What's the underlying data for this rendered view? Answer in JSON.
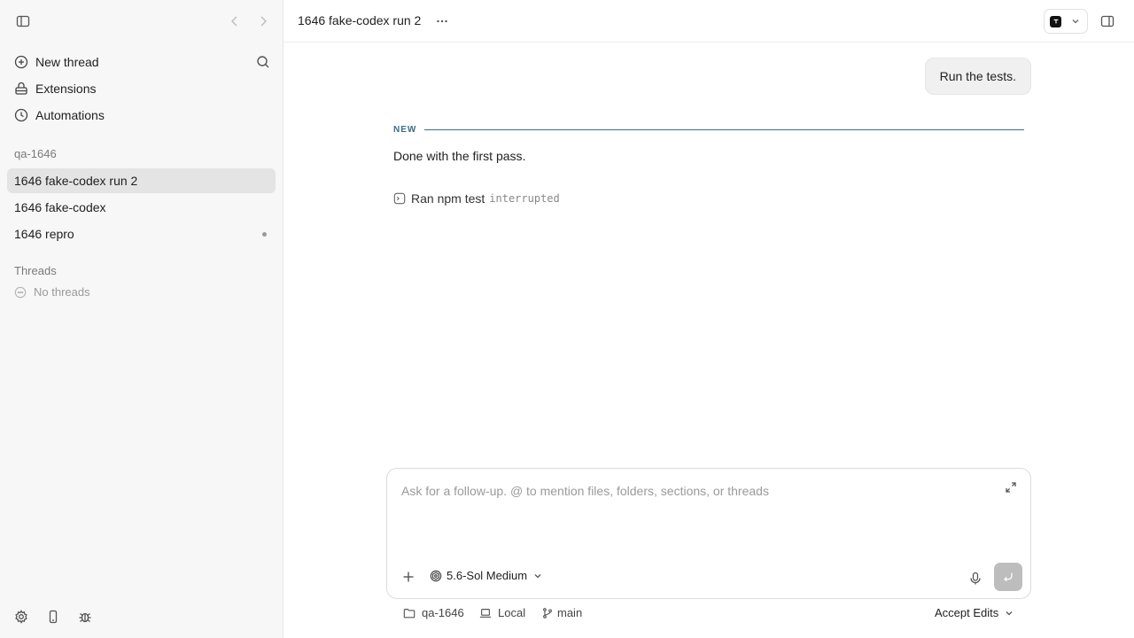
{
  "sidebar": {
    "nav": [
      {
        "label": "New thread",
        "icon": "plus-circle-icon"
      },
      {
        "label": "Extensions",
        "icon": "extensions-icon"
      },
      {
        "label": "Automations",
        "icon": "clock-icon"
      }
    ],
    "project_label": "qa-1646",
    "project_threads": [
      {
        "label": "1646 fake-codex run 2",
        "active": true
      },
      {
        "label": "1646 fake-codex",
        "active": false
      },
      {
        "label": "1646 repro",
        "active": false,
        "unread": true
      }
    ],
    "threads_label": "Threads",
    "threads_empty": "No threads"
  },
  "header": {
    "title": "1646 fake-codex run 2"
  },
  "conversation": {
    "user_message": "Run the tests.",
    "divider_label": "NEW",
    "assistant_message": "Done with the first pass.",
    "tool_call": {
      "label": "Ran npm test",
      "status": "interrupted"
    }
  },
  "composer": {
    "placeholder": "Ask for a follow-up. @ to mention files, folders, sections, or threads",
    "model": "5.6-Sol Medium"
  },
  "footer": {
    "folder": "qa-1646",
    "environment": "Local",
    "branch": "main",
    "mode": "Accept Edits"
  },
  "colors": {
    "accent": "#3b6e86",
    "active_row": "#e4e4e4",
    "send_disabled": "#bdbdbd"
  }
}
